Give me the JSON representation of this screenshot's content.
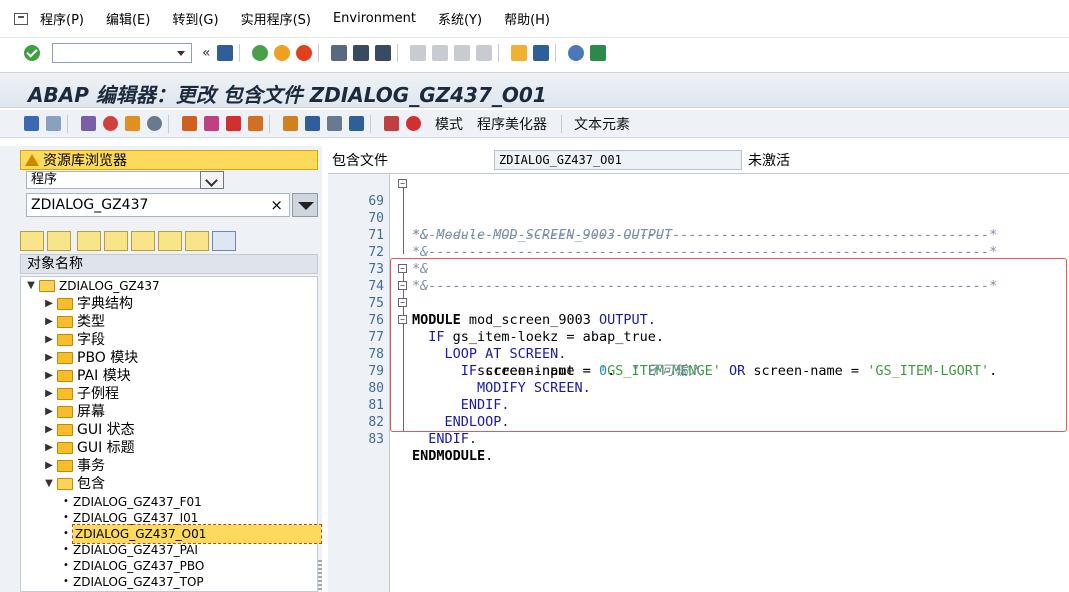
{
  "menubar": {
    "items": [
      "程序(P)",
      "编辑(E)",
      "转到(G)",
      "实用程序(S)",
      "Environment",
      "系统(Y)",
      "帮助(H)"
    ]
  },
  "title": "ABAP 编辑器：更改 包含文件 ZDIALOG_GZ437_O01",
  "appbar": {
    "buttons": [
      "模式",
      "程序美化器",
      "文本元素"
    ]
  },
  "repository": {
    "title": "资源库浏览器",
    "object_type": "程序",
    "object_name": "ZDIALOG_GZ437",
    "clear_symbol": "×",
    "tree_header": "对象名称",
    "root": "ZDIALOG_GZ437",
    "folders": [
      "字典结构",
      "类型",
      "字段",
      "PBO 模块",
      "PAI 模块",
      "子例程",
      "屏幕",
      "GUI 状态",
      "GUI 标题",
      "事务",
      "包含"
    ],
    "includes": [
      "ZDIALOG_GZ437_F01",
      "ZDIALOG_GZ437_I01",
      "ZDIALOG_GZ437_O01",
      "ZDIALOG_GZ437_PAI",
      "ZDIALOG_GZ437_PBO",
      "ZDIALOG_GZ437_TOP"
    ],
    "selected_include": "ZDIALOG_GZ437_O01"
  },
  "include_header": {
    "label": "包含文件",
    "name": "ZDIALOG_GZ437_O01",
    "status": "未激活"
  },
  "editor": {
    "line_numbers": [
      "69",
      "70",
      "71",
      "72",
      "73",
      "74",
      "75",
      "76",
      "77",
      "78",
      "79",
      "80",
      "81",
      "82",
      "83"
    ],
    "lines": {
      "l69": "*&---------------------------------------------------------------------*",
      "l70": "*& Module MOD_SCREEN_9003 OUTPUT",
      "l71": "*&---------------------------------------------------------------------*",
      "l72": "*&",
      "l73": "*&---------------------------------------------------------------------*",
      "l74_kw": "MODULE",
      "l74_name": " mod_screen_9003 ",
      "l74_kw2": "OUTPUT.",
      "l75_kw": "  IF",
      "l75_rest": " gs_item-loekz = abap_true.",
      "l76_kw": "    LOOP AT SCREEN.",
      "l77_kw": "      IF",
      "l77_a": " screen-name = ",
      "l77_s1": "'GS_ITEM-MENGE'",
      "l77_or": " OR",
      "l77_b": " screen-name = ",
      "l77_s2": "'GS_ITEM-LGORT'",
      "l77_end": ".",
      "l78_a": "        screen-input = ",
      "l78_num": "0",
      "l78_b": ".  ",
      "l78_cm": "\" 不可输入",
      "l79_kw": "        MODIFY SCREEN.",
      "l80_kw": "      ENDIF.",
      "l81_kw": "    ENDLOOP.",
      "l82_kw": "  ENDIF.",
      "l83_kw": "ENDMODULE",
      "l83_end": "."
    }
  },
  "colors": {
    "highlight_border": "#e05a5a",
    "selection": "#fdd95c",
    "keyword": "#1a1aa6",
    "string": "#3c9a3c"
  }
}
